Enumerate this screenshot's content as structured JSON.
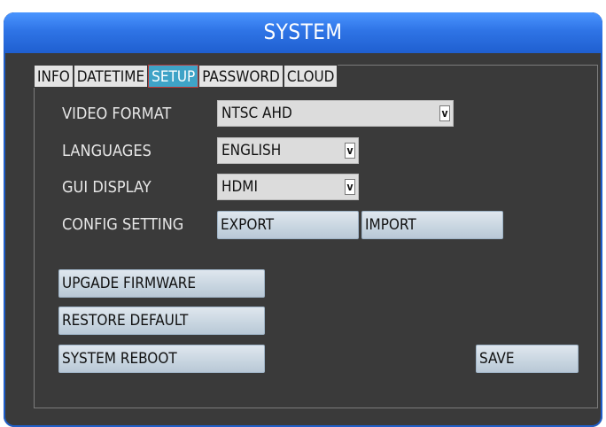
{
  "window": {
    "title": "SYSTEM"
  },
  "tabs": [
    {
      "label": "INFO",
      "active": false
    },
    {
      "label": "DATETIME",
      "active": false
    },
    {
      "label": "SETUP",
      "active": true
    },
    {
      "label": "PASSWORD",
      "active": false
    },
    {
      "label": "CLOUD",
      "active": false
    }
  ],
  "settings": {
    "video_format": {
      "label": "VIDEO FORMAT",
      "value": "NTSC AHD"
    },
    "languages": {
      "label": "LANGUAGES",
      "value": "ENGLISH"
    },
    "gui_display": {
      "label": "GUI DISPLAY",
      "value": "HDMI"
    },
    "config_setting": {
      "label": "CONFIG SETTING",
      "export_label": "EXPORT",
      "import_label": "IMPORT"
    }
  },
  "dropdown_arrow": "v",
  "actions": {
    "upgrade_firmware": "UPGADE FIRMWARE",
    "restore_default": "RESTORE DEFAULT",
    "system_reboot": "SYSTEM REBOOT",
    "save": "SAVE"
  },
  "colors": {
    "title_bar": "#2f74e6",
    "background": "#3a3a3a",
    "active_tab": "#3fa3c7",
    "button": "#c9d6e1"
  }
}
